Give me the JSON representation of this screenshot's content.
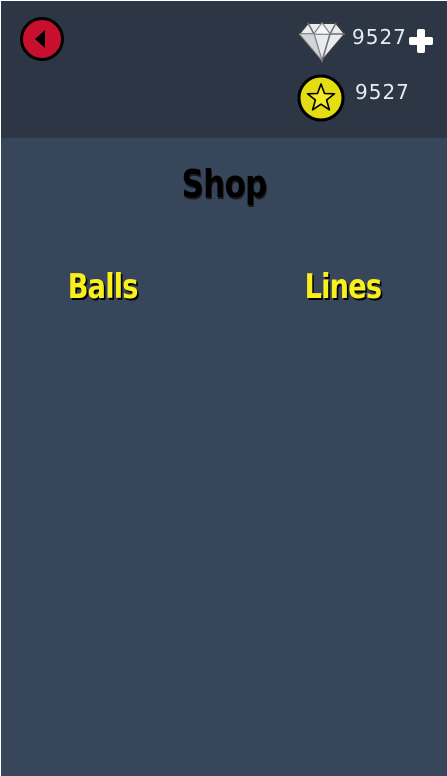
{
  "header": {
    "gems": "9527",
    "coins": "9527"
  },
  "page": {
    "title": "Shop"
  },
  "tabs": [
    {
      "label": "Balls"
    },
    {
      "label": "Lines"
    }
  ],
  "colors": {
    "background": "#37465b",
    "header_background": "#2c3645",
    "tab_text": "#f8ef1c",
    "back_button": "#c8102e",
    "coin": "#e3dd12"
  },
  "icons": {
    "back": "back-arrow-icon",
    "gem": "diamond-icon",
    "add": "plus-icon",
    "coin": "star-coin-icon"
  }
}
